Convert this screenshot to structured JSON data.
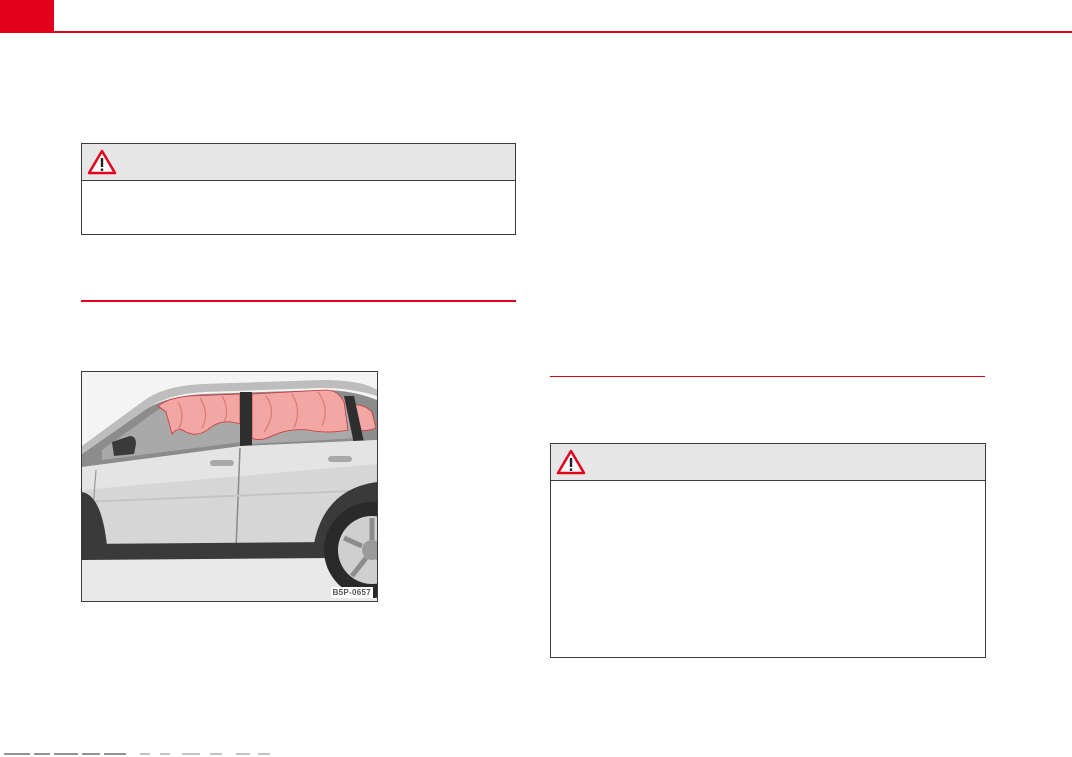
{
  "figure": {
    "code": "B5P-0657",
    "illustration": "car-side-curtain-airbags"
  },
  "warnings": {
    "left": {
      "icon": "warning-triangle-icon"
    },
    "right": {
      "icon": "warning-triangle-icon"
    }
  },
  "colors": {
    "accent": "#e3001b",
    "warning_header": "#e6e6e6",
    "airbag": "#f2a7a5"
  }
}
